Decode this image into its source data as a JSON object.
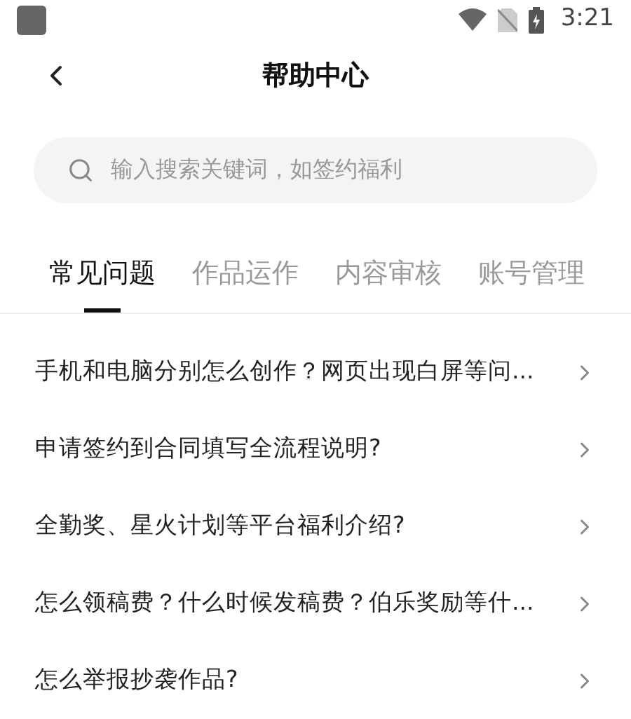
{
  "status_bar": {
    "time": "3:21"
  },
  "header": {
    "title": "帮助中心"
  },
  "search": {
    "placeholder": "输入搜索关键词，如签约福利"
  },
  "tabs": [
    {
      "label": "常见问题",
      "selected": true
    },
    {
      "label": "作品运作",
      "selected": false
    },
    {
      "label": "内容审核",
      "selected": false
    },
    {
      "label": "账号管理",
      "selected": false
    }
  ],
  "questions": [
    "手机和电脑分别怎么创作？网页出现白屏等问...",
    "申请签约到合同填写全流程说明?",
    "全勤奖、星火计划等平台福利介绍?",
    "怎么领稿费？什么时候发稿费？伯乐奖励等什...",
    "怎么举报抄袭作品?"
  ]
}
